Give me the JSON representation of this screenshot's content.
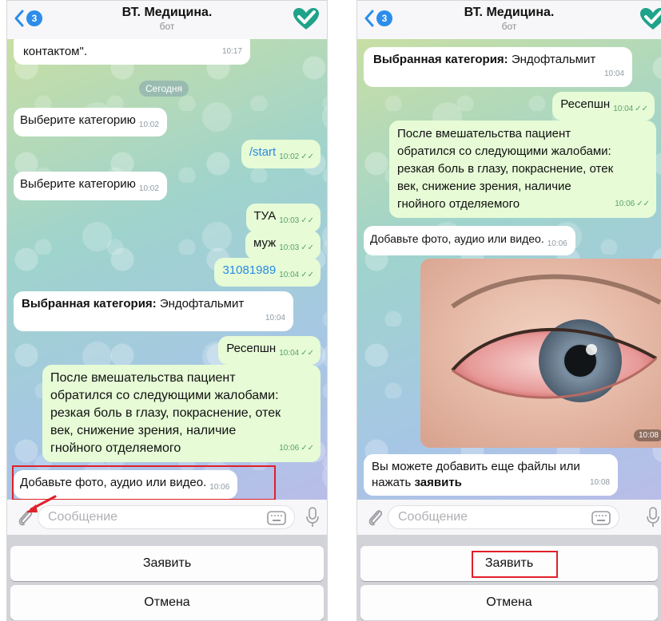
{
  "header": {
    "back_badge": "3",
    "title": "ВТ. Медицина.",
    "subtitle": "бот"
  },
  "left_screen": {
    "date_separator": "Сегодня",
    "messages": [
      {
        "text": "контактом\".",
        "time": "10:17"
      },
      {
        "text": "Выберите категорию",
        "time": "10:02"
      },
      {
        "text": "/start",
        "time": "10:02"
      },
      {
        "text": "Выберите категорию",
        "time": "10:02"
      },
      {
        "text": "ТУА",
        "time": "10:03"
      },
      {
        "text": "муж",
        "time": "10:03"
      },
      {
        "text": "31081989",
        "time": "10:04"
      },
      {
        "bold": "Выбранная категория:",
        "text": " Эндофтальмит",
        "time": "10:04"
      },
      {
        "text": "Ресепшн",
        "time": "10:04"
      },
      {
        "lines": [
          "После вмешательства пациент",
          "обратился со следующими жалобами:",
          "резкая боль в глазу, покраснение, отек",
          "век, снижение зрения, наличие",
          "гнойного отделяемого"
        ],
        "time": "10:06"
      },
      {
        "text": "Добавьте фото, аудио или видео.",
        "time": "10:06"
      }
    ]
  },
  "right_screen": {
    "messages": [
      {
        "bold": "Выбранная категория:",
        "text": " Эндофтальмит",
        "time": "10:04"
      },
      {
        "text": "Ресепшн",
        "time": "10:04"
      },
      {
        "lines": [
          "После вмешательства пациент",
          "обратился со следующими жалобами:",
          "резкая боль в глазу, покраснение, отек",
          "век, снижение зрения, наличие",
          "гнойного отделяемого"
        ],
        "time": "10:06"
      },
      {
        "text": "Добавьте фото, аудио или видео.",
        "time": "10:06"
      },
      {
        "photo_time": "10:08"
      },
      {
        "line1": "Вы можете добавить еще файлы или",
        "line2_prefix": "нажать ",
        "line2_bold": "заявить",
        "time": "10:08"
      }
    ]
  },
  "input": {
    "placeholder": "Сообщение"
  },
  "keyboard": {
    "submit_label": "Заявить",
    "cancel_label": "Отмена"
  },
  "icons": {
    "back": "chevron-left-icon",
    "logo": "heart-check-logo",
    "attach": "paperclip-icon",
    "keyboard": "keyboard-icon",
    "mic": "microphone-icon",
    "read": "double-check-icon"
  },
  "colors": {
    "accent": "#2c8dea",
    "logo": "#1fa38a",
    "highlight": "#e0202a",
    "outgoing_bubble": "#e6fbd6"
  }
}
